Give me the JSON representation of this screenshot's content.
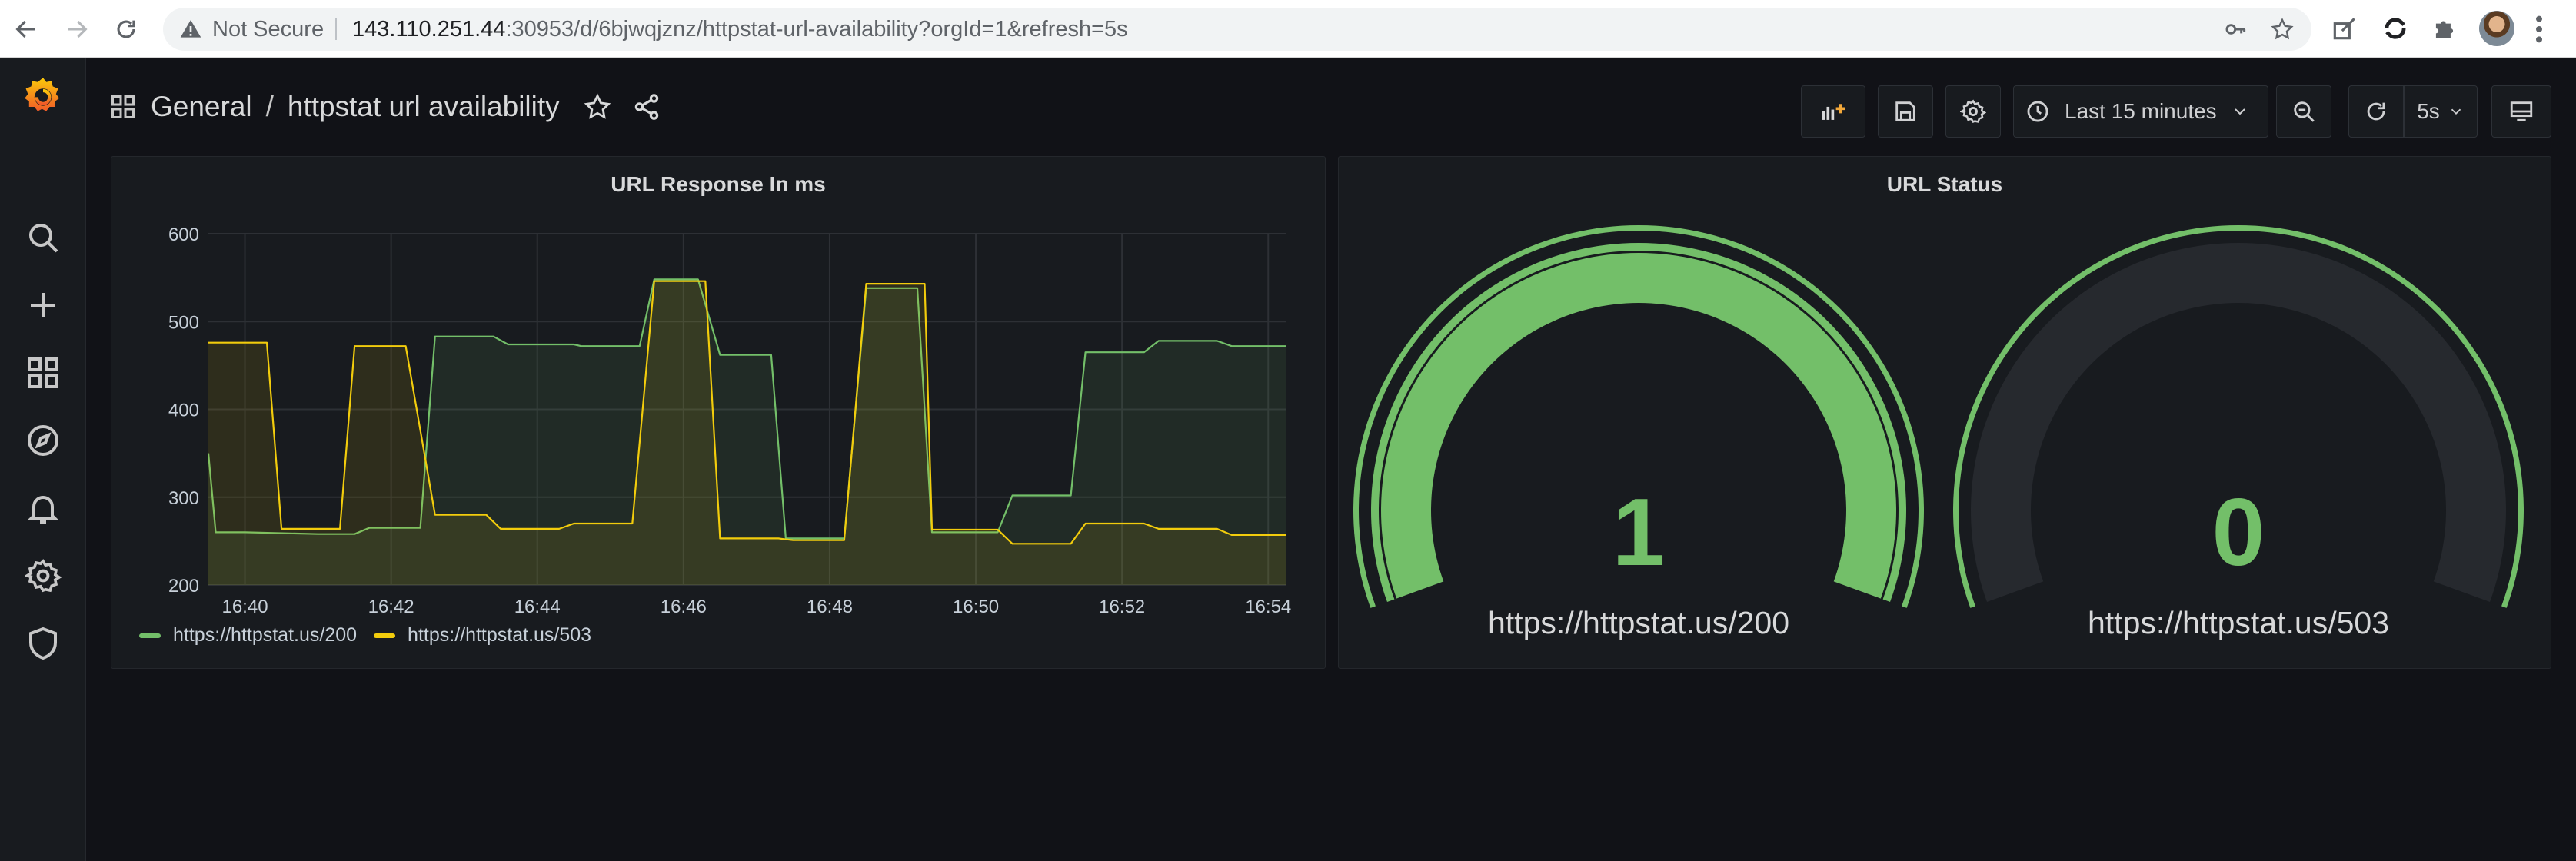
{
  "browser": {
    "security_label": "Not Secure",
    "url_host": "143.110.251.44",
    "url_rest": ":30953/d/6bjwqjznz/httpstat-url-availability?orgId=1&refresh=5s"
  },
  "sidebar": {
    "items": [
      {
        "icon": "search-icon"
      },
      {
        "icon": "plus-icon"
      },
      {
        "icon": "dashboards-icon"
      },
      {
        "icon": "compass-icon"
      },
      {
        "icon": "bell-icon"
      },
      {
        "icon": "gear-icon"
      },
      {
        "icon": "shield-icon"
      }
    ]
  },
  "header": {
    "folder": "General",
    "separator": "/",
    "title": "httpstat url availability",
    "time_range": "Last 15 minutes",
    "refresh": "5s"
  },
  "panels": {
    "response": {
      "title": "URL Response In ms",
      "legend": [
        {
          "name": "https://httpstat.us/200",
          "color": "#73bf69"
        },
        {
          "name": "https://httpstat.us/503",
          "color": "#f2cc0c"
        }
      ]
    },
    "status": {
      "title": "URL Status",
      "gauges": [
        {
          "value": "1",
          "label": "https://httpstat.us/200",
          "level": 1
        },
        {
          "value": "0",
          "label": "https://httpstat.us/503",
          "level": 0
        }
      ]
    }
  },
  "colors": {
    "green": "#73bf69",
    "yellow": "#f2cc0c",
    "bg": "#111217",
    "panel": "#181b1f"
  },
  "chart_data": {
    "type": "line",
    "title": "URL Response In ms",
    "xlabel": "",
    "ylabel": "",
    "ylim": [
      200,
      600
    ],
    "yticks": [
      "200",
      "300",
      "400",
      "500",
      "600"
    ],
    "xticks": [
      "16:40",
      "16:42",
      "16:44",
      "16:46",
      "16:48",
      "16:50",
      "16:52",
      "16:54"
    ],
    "xlim_minutes": [
      39.5,
      54.25
    ],
    "grid": true,
    "legend": "bottom-left",
    "series": [
      {
        "name": "https://httpstat.us/200",
        "color": "#73bf69",
        "points": [
          [
            39.5,
            350
          ],
          [
            39.6,
            260
          ],
          [
            40.0,
            260
          ],
          [
            41.0,
            258
          ],
          [
            41.5,
            258
          ],
          [
            41.7,
            265
          ],
          [
            42.0,
            265
          ],
          [
            42.4,
            265
          ],
          [
            42.6,
            483
          ],
          [
            43.0,
            483
          ],
          [
            43.4,
            483
          ],
          [
            43.6,
            474
          ],
          [
            44.0,
            474
          ],
          [
            44.5,
            474
          ],
          [
            44.6,
            472
          ],
          [
            45.0,
            472
          ],
          [
            45.4,
            472
          ],
          [
            45.6,
            548
          ],
          [
            46.0,
            548
          ],
          [
            46.2,
            548
          ],
          [
            46.5,
            462
          ],
          [
            47.0,
            462
          ],
          [
            47.2,
            462
          ],
          [
            47.4,
            253
          ],
          [
            48.0,
            253
          ],
          [
            48.2,
            253
          ],
          [
            48.5,
            538
          ],
          [
            49.0,
            538
          ],
          [
            49.2,
            538
          ],
          [
            49.4,
            260
          ],
          [
            50.0,
            260
          ],
          [
            50.3,
            260
          ],
          [
            50.5,
            302
          ],
          [
            51.0,
            302
          ],
          [
            51.3,
            302
          ],
          [
            51.5,
            465
          ],
          [
            52.0,
            465
          ],
          [
            52.3,
            465
          ],
          [
            52.5,
            478
          ],
          [
            53.0,
            478
          ],
          [
            53.3,
            478
          ],
          [
            53.5,
            472
          ],
          [
            54.25,
            472
          ]
        ]
      },
      {
        "name": "https://httpstat.us/503",
        "color": "#f2cc0c",
        "points": [
          [
            39.5,
            476
          ],
          [
            40.0,
            476
          ],
          [
            40.3,
            476
          ],
          [
            40.5,
            264
          ],
          [
            41.0,
            264
          ],
          [
            41.3,
            264
          ],
          [
            41.5,
            472
          ],
          [
            42.0,
            472
          ],
          [
            42.2,
            472
          ],
          [
            42.6,
            280
          ],
          [
            43.0,
            280
          ],
          [
            43.3,
            280
          ],
          [
            43.5,
            264
          ],
          [
            44.0,
            264
          ],
          [
            44.3,
            264
          ],
          [
            44.5,
            270
          ],
          [
            45.0,
            270
          ],
          [
            45.3,
            270
          ],
          [
            45.6,
            546
          ],
          [
            46.0,
            546
          ],
          [
            46.3,
            546
          ],
          [
            46.5,
            253
          ],
          [
            47.0,
            253
          ],
          [
            47.3,
            253
          ],
          [
            47.5,
            251
          ],
          [
            48.0,
            251
          ],
          [
            48.2,
            251
          ],
          [
            48.5,
            543
          ],
          [
            49.0,
            543
          ],
          [
            49.3,
            543
          ],
          [
            49.4,
            263
          ],
          [
            50.0,
            263
          ],
          [
            50.3,
            263
          ],
          [
            50.5,
            247
          ],
          [
            51.0,
            247
          ],
          [
            51.3,
            247
          ],
          [
            51.5,
            270
          ],
          [
            52.0,
            270
          ],
          [
            52.3,
            270
          ],
          [
            52.5,
            264
          ],
          [
            53.0,
            264
          ],
          [
            53.3,
            264
          ],
          [
            53.5,
            257
          ],
          [
            54.25,
            257
          ]
        ]
      }
    ]
  }
}
